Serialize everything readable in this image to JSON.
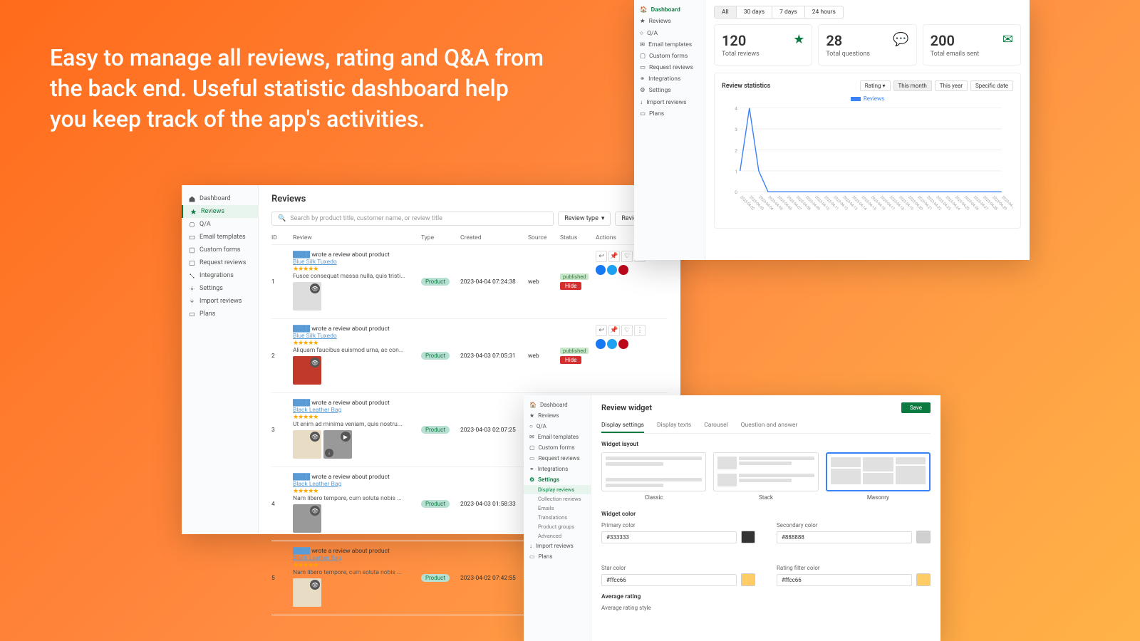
{
  "hero": "Easy to manage all reviews, rating and Q&A from the back end. Useful statistic dashboard help you keep track of the app's activities.",
  "reviews_panel": {
    "nav": [
      "Dashboard",
      "Reviews",
      "Q/A",
      "Email templates",
      "Custom forms",
      "Request reviews",
      "Integrations",
      "Settings",
      "Import reviews",
      "Plans"
    ],
    "title": "Reviews",
    "search_placeholder": "Search by product title, customer name, or review title",
    "filter1": "Review type",
    "filter2": "Review status",
    "cols": {
      "id": "ID",
      "review": "Review",
      "type": "Type",
      "created": "Created",
      "source": "Source",
      "status": "Status",
      "actions": "Actions"
    },
    "rows": [
      {
        "id": "1",
        "author": "████",
        "verb": "wrote a review about product",
        "product": "Blue Silk Tuxedo",
        "snippet": "Fusce consequat massa nulla, quis tristi...",
        "type": "Product",
        "created": "2023-04-04 07:24:38",
        "source": "web",
        "status": "published",
        "hide": "Hide"
      },
      {
        "id": "2",
        "author": "████",
        "verb": "wrote a review about product",
        "product": "Blue Silk Tuxedo",
        "snippet": "Aliquam faucibus euismod urna, ac con...",
        "type": "Product",
        "created": "2023-04-03 07:05:31",
        "source": "web",
        "status": "published",
        "hide": "Hide"
      },
      {
        "id": "3",
        "author": "████",
        "verb": "wrote a review about product",
        "product": "Black Leather Bag",
        "snippet": "Ut enim ad minima veniam, quis nostru...",
        "type": "Product",
        "created": "2023-04-03 02:07:25",
        "source": "web",
        "status": "",
        "hide": ""
      },
      {
        "id": "4",
        "author": "████",
        "verb": "wrote a review about product",
        "product": "Black Leather Bag",
        "snippet": "Nam libero tempore, cum soluta nobis ...",
        "type": "Product",
        "created": "2023-04-03 01:58:33",
        "source": "web",
        "status": "",
        "hide": ""
      },
      {
        "id": "5",
        "author": "████",
        "verb": "wrote a review about product",
        "product": "Black Leather Bag",
        "snippet": "Nam libero tempore, cum soluta nobis ...",
        "type": "Product",
        "created": "2023-04-02 07:42:55",
        "source": "web",
        "status": "",
        "hide": ""
      }
    ]
  },
  "dash_panel": {
    "nav": [
      "Dashboard",
      "Reviews",
      "Q/A",
      "Email templates",
      "Custom forms",
      "Request reviews",
      "Integrations",
      "Settings",
      "Import reviews",
      "Plans"
    ],
    "tabs": [
      "All",
      "30 days",
      "7 days",
      "24 hours"
    ],
    "stats": [
      {
        "num": "120",
        "label": "Total reviews"
      },
      {
        "num": "28",
        "label": "Total questions"
      },
      {
        "num": "200",
        "label": "Total emails sent"
      }
    ],
    "chart_title": "Review statistics",
    "chart_filters": [
      "Rating",
      "This month",
      "This year",
      "Specific date"
    ],
    "legend": "Reviews"
  },
  "chart_data": {
    "type": "line",
    "title": "Review statistics",
    "xlabel": "",
    "ylabel": "",
    "ylim": [
      0,
      4
    ],
    "categories": [
      "2023-04-02",
      "2023-04-03",
      "2023-04-04",
      "2023-04-05",
      "2023-04-06",
      "2023-04-07",
      "2023-04-08",
      "2023-04-09",
      "2023-04-10",
      "2023-04-11",
      "2023-04-12",
      "2023-04-13",
      "2023-04-14",
      "2023-04-15",
      "2023-04-16",
      "2023-04-17",
      "2023-04-18",
      "2023-04-19",
      "2023-04-20",
      "2023-04-21",
      "2023-04-22",
      "2023-04-23",
      "2023-04-24",
      "2023-04-25",
      "2023-04-26",
      "2023-04-27",
      "2023-04-28",
      "2023-04-29",
      "2023-04-30"
    ],
    "series": [
      {
        "name": "Reviews",
        "values": [
          1,
          4,
          1,
          0,
          0,
          0,
          0,
          0,
          0,
          0,
          0,
          0,
          0,
          0,
          0,
          0,
          0,
          0,
          0,
          0,
          0,
          0,
          0,
          0,
          0,
          0,
          0,
          0,
          0
        ]
      }
    ]
  },
  "widget_panel": {
    "nav": [
      "Dashboard",
      "Reviews",
      "Q/A",
      "Email templates",
      "Custom forms",
      "Request reviews",
      "Integrations",
      "Settings"
    ],
    "sub_nav": [
      "Display reviews",
      "Collection reviews",
      "Emails",
      "Translations",
      "Product groups",
      "Advanced"
    ],
    "nav2": [
      "Import reviews",
      "Plans"
    ],
    "title": "Review widget",
    "save": "Save",
    "tabs": [
      "Display settings",
      "Display texts",
      "Carousel",
      "Question and answer"
    ],
    "layout_label": "Widget layout",
    "layouts": [
      "Classic",
      "Stack",
      "Masonry"
    ],
    "color_label": "Widget color",
    "colors": {
      "primary": {
        "label": "Primary color",
        "value": "#333333",
        "hex": "#333333"
      },
      "secondary": {
        "label": "Secondary color",
        "value": "#888888",
        "hex": "#d0d0d0"
      },
      "star": {
        "label": "Star color",
        "value": "#ffcc66",
        "hex": "#ffcc66"
      },
      "filter": {
        "label": "Rating filter color",
        "value": "#ffcc66",
        "hex": "#ffcc66"
      }
    },
    "avg_label": "Average rating",
    "avg_style": "Average rating style"
  }
}
